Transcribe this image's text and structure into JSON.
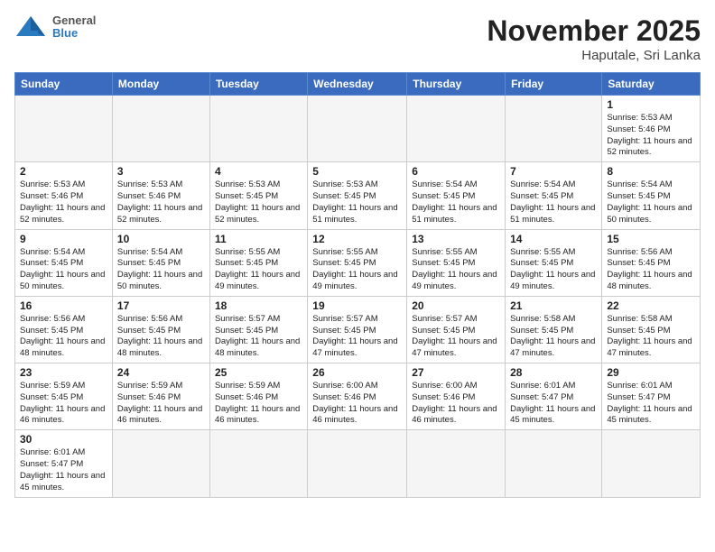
{
  "header": {
    "month_title": "November 2025",
    "location": "Haputale, Sri Lanka",
    "logo_general": "General",
    "logo_blue": "Blue"
  },
  "weekdays": [
    "Sunday",
    "Monday",
    "Tuesday",
    "Wednesday",
    "Thursday",
    "Friday",
    "Saturday"
  ],
  "weeks": [
    [
      {
        "day": "",
        "info": ""
      },
      {
        "day": "",
        "info": ""
      },
      {
        "day": "",
        "info": ""
      },
      {
        "day": "",
        "info": ""
      },
      {
        "day": "",
        "info": ""
      },
      {
        "day": "",
        "info": ""
      },
      {
        "day": "1",
        "info": "Sunrise: 5:53 AM\nSunset: 5:46 PM\nDaylight: 11 hours\nand 52 minutes."
      }
    ],
    [
      {
        "day": "2",
        "info": "Sunrise: 5:53 AM\nSunset: 5:46 PM\nDaylight: 11 hours\nand 52 minutes."
      },
      {
        "day": "3",
        "info": "Sunrise: 5:53 AM\nSunset: 5:46 PM\nDaylight: 11 hours\nand 52 minutes."
      },
      {
        "day": "4",
        "info": "Sunrise: 5:53 AM\nSunset: 5:45 PM\nDaylight: 11 hours\nand 52 minutes."
      },
      {
        "day": "5",
        "info": "Sunrise: 5:53 AM\nSunset: 5:45 PM\nDaylight: 11 hours\nand 51 minutes."
      },
      {
        "day": "6",
        "info": "Sunrise: 5:54 AM\nSunset: 5:45 PM\nDaylight: 11 hours\nand 51 minutes."
      },
      {
        "day": "7",
        "info": "Sunrise: 5:54 AM\nSunset: 5:45 PM\nDaylight: 11 hours\nand 51 minutes."
      },
      {
        "day": "8",
        "info": "Sunrise: 5:54 AM\nSunset: 5:45 PM\nDaylight: 11 hours\nand 50 minutes."
      }
    ],
    [
      {
        "day": "9",
        "info": "Sunrise: 5:54 AM\nSunset: 5:45 PM\nDaylight: 11 hours\nand 50 minutes."
      },
      {
        "day": "10",
        "info": "Sunrise: 5:54 AM\nSunset: 5:45 PM\nDaylight: 11 hours\nand 50 minutes."
      },
      {
        "day": "11",
        "info": "Sunrise: 5:55 AM\nSunset: 5:45 PM\nDaylight: 11 hours\nand 49 minutes."
      },
      {
        "day": "12",
        "info": "Sunrise: 5:55 AM\nSunset: 5:45 PM\nDaylight: 11 hours\nand 49 minutes."
      },
      {
        "day": "13",
        "info": "Sunrise: 5:55 AM\nSunset: 5:45 PM\nDaylight: 11 hours\nand 49 minutes."
      },
      {
        "day": "14",
        "info": "Sunrise: 5:55 AM\nSunset: 5:45 PM\nDaylight: 11 hours\nand 49 minutes."
      },
      {
        "day": "15",
        "info": "Sunrise: 5:56 AM\nSunset: 5:45 PM\nDaylight: 11 hours\nand 48 minutes."
      }
    ],
    [
      {
        "day": "16",
        "info": "Sunrise: 5:56 AM\nSunset: 5:45 PM\nDaylight: 11 hours\nand 48 minutes."
      },
      {
        "day": "17",
        "info": "Sunrise: 5:56 AM\nSunset: 5:45 PM\nDaylight: 11 hours\nand 48 minutes."
      },
      {
        "day": "18",
        "info": "Sunrise: 5:57 AM\nSunset: 5:45 PM\nDaylight: 11 hours\nand 48 minutes."
      },
      {
        "day": "19",
        "info": "Sunrise: 5:57 AM\nSunset: 5:45 PM\nDaylight: 11 hours\nand 47 minutes."
      },
      {
        "day": "20",
        "info": "Sunrise: 5:57 AM\nSunset: 5:45 PM\nDaylight: 11 hours\nand 47 minutes."
      },
      {
        "day": "21",
        "info": "Sunrise: 5:58 AM\nSunset: 5:45 PM\nDaylight: 11 hours\nand 47 minutes."
      },
      {
        "day": "22",
        "info": "Sunrise: 5:58 AM\nSunset: 5:45 PM\nDaylight: 11 hours\nand 47 minutes."
      }
    ],
    [
      {
        "day": "23",
        "info": "Sunrise: 5:59 AM\nSunset: 5:45 PM\nDaylight: 11 hours\nand 46 minutes."
      },
      {
        "day": "24",
        "info": "Sunrise: 5:59 AM\nSunset: 5:46 PM\nDaylight: 11 hours\nand 46 minutes."
      },
      {
        "day": "25",
        "info": "Sunrise: 5:59 AM\nSunset: 5:46 PM\nDaylight: 11 hours\nand 46 minutes."
      },
      {
        "day": "26",
        "info": "Sunrise: 6:00 AM\nSunset: 5:46 PM\nDaylight: 11 hours\nand 46 minutes."
      },
      {
        "day": "27",
        "info": "Sunrise: 6:00 AM\nSunset: 5:46 PM\nDaylight: 11 hours\nand 46 minutes."
      },
      {
        "day": "28",
        "info": "Sunrise: 6:01 AM\nSunset: 5:47 PM\nDaylight: 11 hours\nand 45 minutes."
      },
      {
        "day": "29",
        "info": "Sunrise: 6:01 AM\nSunset: 5:47 PM\nDaylight: 11 hours\nand 45 minutes."
      }
    ],
    [
      {
        "day": "30",
        "info": "Sunrise: 6:01 AM\nSunset: 5:47 PM\nDaylight: 11 hours\nand 45 minutes."
      },
      {
        "day": "",
        "info": ""
      },
      {
        "day": "",
        "info": ""
      },
      {
        "day": "",
        "info": ""
      },
      {
        "day": "",
        "info": ""
      },
      {
        "day": "",
        "info": ""
      },
      {
        "day": "",
        "info": ""
      }
    ]
  ]
}
